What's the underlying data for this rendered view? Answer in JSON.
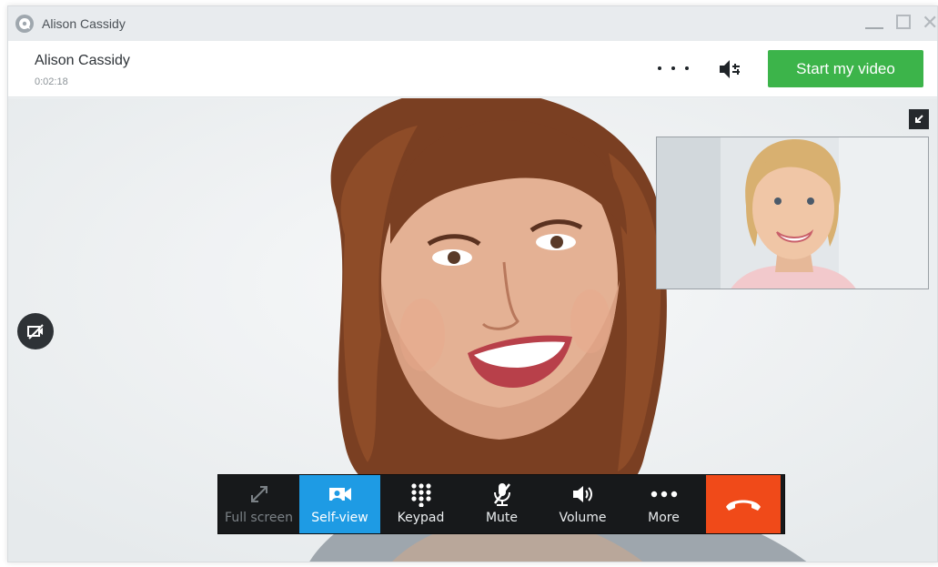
{
  "window": {
    "title": "Alison Cassidy"
  },
  "header": {
    "contact_name": "Alison Cassidy",
    "call_timer": "0:02:18",
    "start_video_label": "Start my video",
    "accent_color": "#3cb44a"
  },
  "icons": {
    "app": "chat-bubble-icon",
    "more": "more-dots-icon",
    "speaker": "speaker-settings-icon",
    "collapse": "collapse-arrow-icon",
    "sidebar": "hide-video-icon"
  },
  "controls": [
    {
      "label": "Full screen",
      "icon": "fullscreen-icon",
      "state": "disabled"
    },
    {
      "label": "Self-view",
      "icon": "camera-icon",
      "state": "active"
    },
    {
      "label": "Keypad",
      "icon": "keypad-icon",
      "state": "normal"
    },
    {
      "label": "Mute",
      "icon": "mic-mute-icon",
      "state": "normal"
    },
    {
      "label": "Volume",
      "icon": "volume-icon",
      "state": "normal"
    },
    {
      "label": "More",
      "icon": "more-icon",
      "state": "normal"
    }
  ],
  "hangup": {
    "icon": "end-call-icon",
    "color": "#f04a19"
  },
  "colors": {
    "self_view_active": "#1e9be4",
    "control_bar": "#17191b"
  }
}
